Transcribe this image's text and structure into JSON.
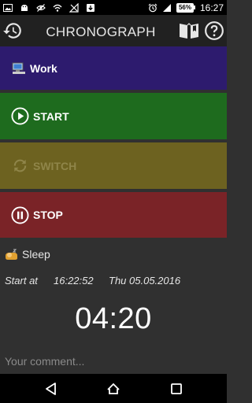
{
  "status_bar": {
    "battery": "56%",
    "time": "16:27",
    "icons": [
      "image-icon",
      "android-debug-icon",
      "eye-off-icon",
      "wifi-icon",
      "signal-off-icon",
      "download-icon",
      "alarm-icon",
      "cellular-signal-icon",
      "battery-icon"
    ]
  },
  "app_bar": {
    "title": "CHRONOGRAPH",
    "icons": [
      "history-icon",
      "book-icon",
      "help-icon"
    ]
  },
  "panels": {
    "work": {
      "label": "Work",
      "icon": "computer-icon",
      "color": "#2d1b6e"
    },
    "start": {
      "label": "START",
      "icon": "play-icon",
      "color": "#1e6b1e"
    },
    "switch": {
      "label": "SWITCH",
      "icon": "switch-icon",
      "color": "#6d6220"
    },
    "stop": {
      "label": "STOP",
      "icon": "pause-icon",
      "color": "#7a2327"
    }
  },
  "current": {
    "activity": "Sleep",
    "activity_icon": "sleep-icon",
    "start_label": "Start at",
    "start_time": "16:22:52",
    "start_date": "Thu 05.05.2016",
    "elapsed": "04:20"
  },
  "comment": {
    "placeholder": "Your comment...",
    "value": ""
  },
  "nav_bar": {
    "icons": [
      "back-icon",
      "home-icon",
      "recents-icon"
    ]
  }
}
